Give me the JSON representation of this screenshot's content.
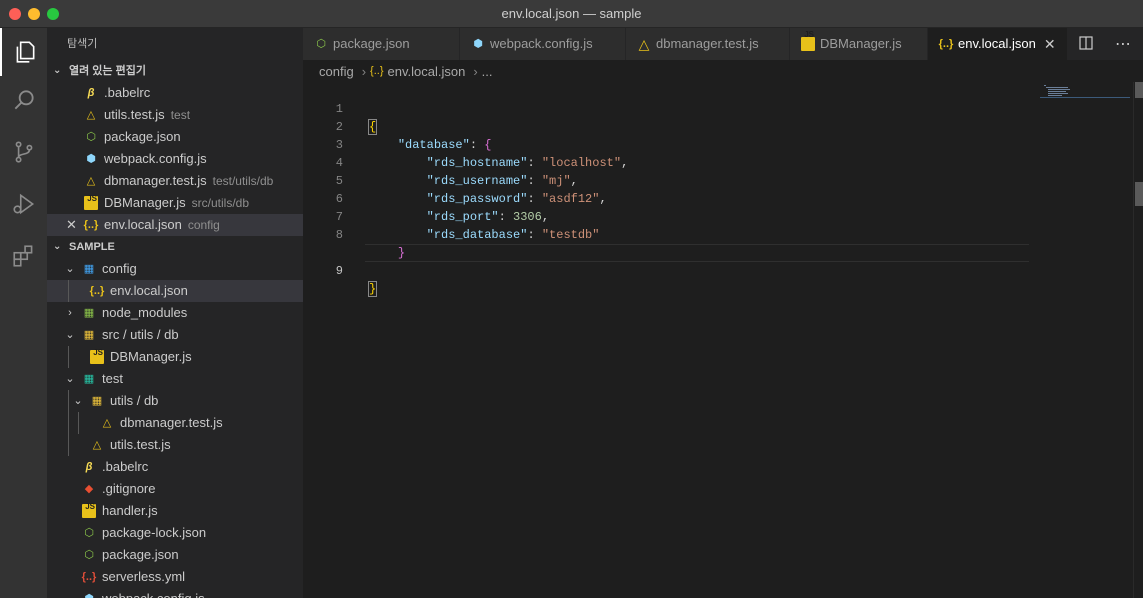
{
  "window": {
    "title": "env.local.json — sample"
  },
  "sidebar": {
    "title": "탐색기",
    "open_editors_header": "열려 있는 편집기",
    "open_editors": [
      {
        "label": ".babelrc",
        "desc": "",
        "icon": "babel-icon"
      },
      {
        "label": "utils.test.js",
        "desc": "test",
        "icon": "flask-icon"
      },
      {
        "label": "package.json",
        "desc": "",
        "icon": "nodejs-icon"
      },
      {
        "label": "webpack.config.js",
        "desc": "",
        "icon": "webpack-icon"
      },
      {
        "label": "dbmanager.test.js",
        "desc": "test/utils/db",
        "icon": "flask-icon"
      },
      {
        "label": "DBManager.js",
        "desc": "src/utils/db",
        "icon": "js-icon"
      },
      {
        "label": "env.local.json",
        "desc": "config",
        "icon": "json-icon"
      }
    ],
    "workspace_header": "SAMPLE",
    "tree": {
      "config": "config",
      "env_local": "env.local.json",
      "node_modules": "node_modules",
      "src_utils_db": "src / utils / db",
      "dbmanager_js": "DBManager.js",
      "test": "test",
      "utils_db": "utils / db",
      "dbmanager_test": "dbmanager.test.js",
      "utils_test": "utils.test.js",
      "babelrc": ".babelrc",
      "gitignore": ".gitignore",
      "handler": "handler.js",
      "package_lock": "package-lock.json",
      "package_json": "package.json",
      "serverless": "serverless.yml",
      "webpack": "webpack.config.js"
    }
  },
  "tabs": [
    {
      "label": "package.json",
      "icon": "nodejs-icon"
    },
    {
      "label": "webpack.config.js",
      "icon": "webpack-icon"
    },
    {
      "label": "dbmanager.test.js",
      "icon": "flask-icon"
    },
    {
      "label": "DBManager.js",
      "icon": "js-icon"
    },
    {
      "label": "env.local.json",
      "icon": "json-icon",
      "active": true
    }
  ],
  "breadcrumb": {
    "folder": "config",
    "file": "env.local.json",
    "more": "..."
  },
  "editor": {
    "line_numbers": [
      "1",
      "2",
      "3",
      "4",
      "5",
      "6",
      "7",
      "8",
      "9"
    ],
    "db_key": "\"database\"",
    "hostname_key": "\"rds_hostname\"",
    "hostname_val": "\"localhost\"",
    "username_key": "\"rds_username\"",
    "username_val": "\"mj\"",
    "password_key": "\"rds_password\"",
    "password_val": "\"asdf12\"",
    "port_key": "\"rds_port\"",
    "port_val": "3306",
    "database_key": "\"rds_database\"",
    "database_val": "\"testdb\""
  },
  "colors": {
    "key": "#9cdcfe",
    "string": "#ce9178",
    "number": "#b5cea8",
    "bracket_outer": "#ffd700",
    "bracket_inner": "#da70d6"
  }
}
